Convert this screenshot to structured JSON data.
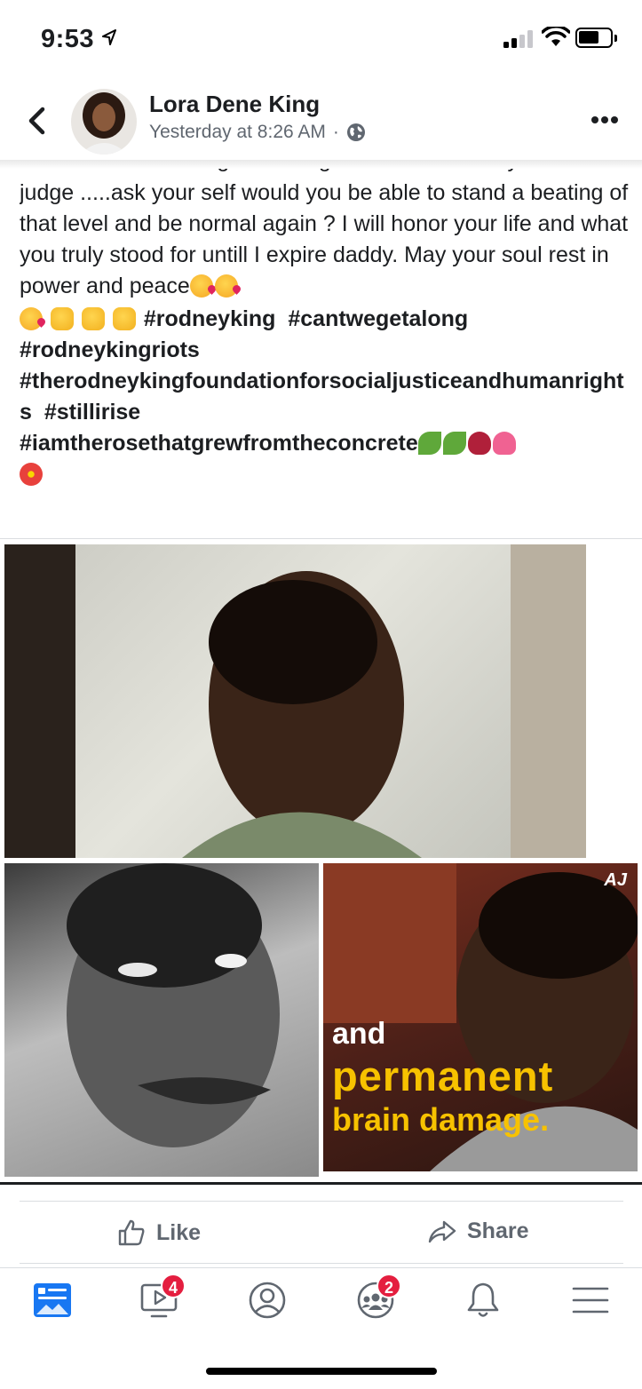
{
  "status_bar": {
    "time": "9:53"
  },
  "post": {
    "author": "Lora Dene King",
    "time": "Yesterday at 8:26 AM",
    "time_separator": "·",
    "cut_line": "have lost him that night so I'm grateful. So before you",
    "paragraph": "judge .....ask your self would you be able to stand a beating of that level and be normal again ? I will honor your life and what  you truly stood for untill I expire daddy.  May your soul rest in power and peace",
    "hashtags": [
      "#rodneyking",
      "#cantwegetalong",
      "#rodneykingriots",
      "#therodneykingfoundationforsocialjusticeandhumanrights",
      "#stillirise",
      "#iamtherosethatgrewfromtheconcrete"
    ],
    "images": {
      "caption_line1": "and",
      "caption_line2": "permanent",
      "caption_line3": "brain damage.",
      "logo": "AJ"
    }
  },
  "actions": {
    "like": "Like",
    "share": "Share"
  },
  "tab_bar": {
    "tabs": [
      {
        "name": "news-feed",
        "badge": ""
      },
      {
        "name": "watch",
        "badge": "4"
      },
      {
        "name": "profile",
        "badge": ""
      },
      {
        "name": "groups",
        "badge": "2"
      },
      {
        "name": "notifications",
        "badge": ""
      },
      {
        "name": "menu",
        "badge": ""
      }
    ]
  },
  "colors": {
    "accent": "#1877f2",
    "badge": "#e41e3f",
    "caption_yellow": "#f7c200",
    "secondary_text": "#606770"
  }
}
